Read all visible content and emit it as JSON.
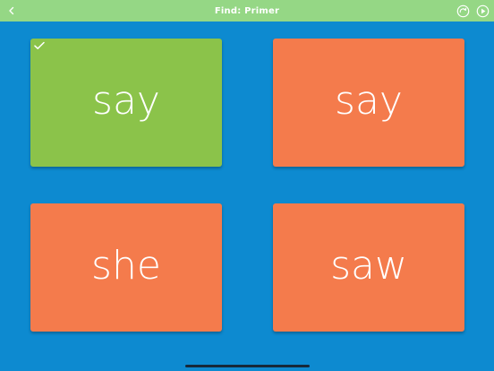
{
  "header": {
    "title": "Find: Primer",
    "back_icon": "chevron-left-icon",
    "skip_icon": "skip-forward-circle-icon",
    "play_icon": "play-circle-icon"
  },
  "colors": {
    "background": "#0D8AD0",
    "header": "#95D785",
    "correct_card": "#8BC34A",
    "card": "#F47B4C"
  },
  "cards": [
    {
      "word": "say",
      "state": "correct",
      "color": "#8BC34A",
      "check_icon": "checkmark-icon"
    },
    {
      "word": "say",
      "state": "default",
      "color": "#F47B4C"
    },
    {
      "word": "she",
      "state": "default",
      "color": "#F47B4C"
    },
    {
      "word": "saw",
      "state": "default",
      "color": "#F47B4C"
    }
  ]
}
